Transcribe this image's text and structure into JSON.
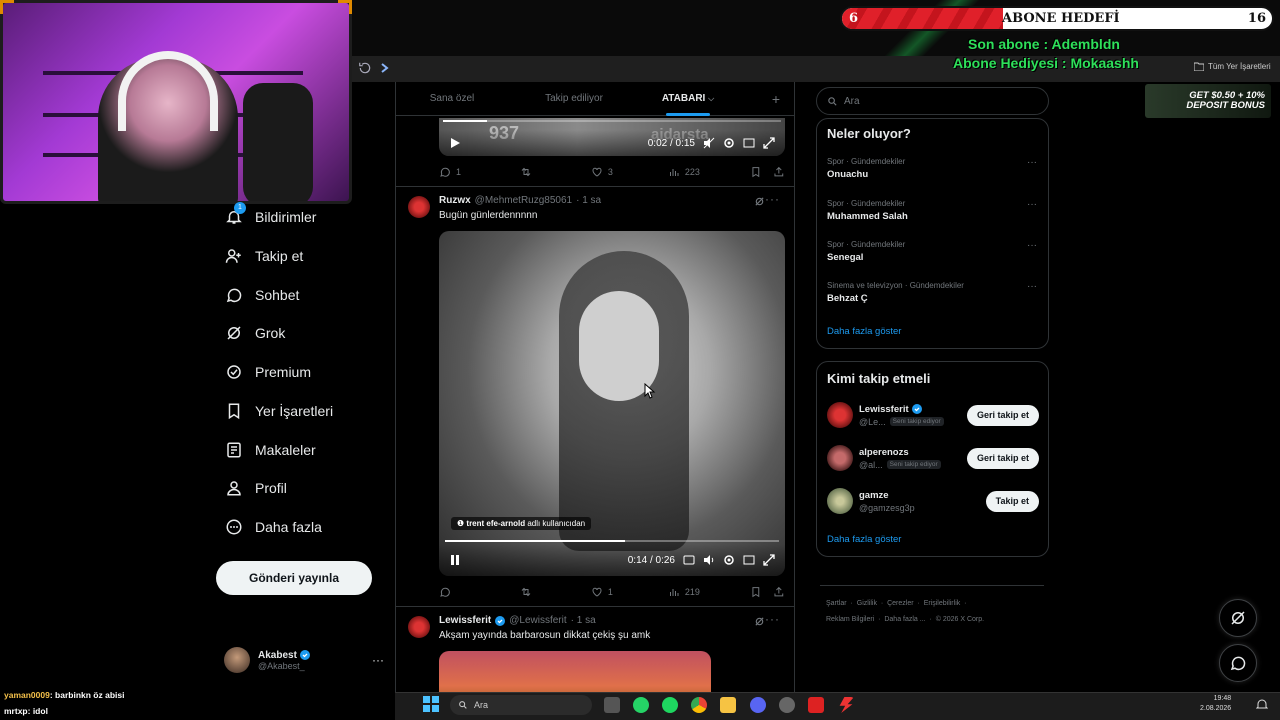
{
  "nav": {
    "items": [
      {
        "label": "Bildirimler",
        "icon": "bell-icon",
        "badge": "1"
      },
      {
        "label": "Takip et",
        "icon": "person-add-icon"
      },
      {
        "label": "Sohbet",
        "icon": "chat-icon"
      },
      {
        "label": "Grok",
        "icon": "grok-icon"
      },
      {
        "label": "Premium",
        "icon": "premium-icon"
      },
      {
        "label": "Yer İşaretleri",
        "icon": "bookmark-icon"
      },
      {
        "label": "Makaleler",
        "icon": "article-icon"
      },
      {
        "label": "Profil",
        "icon": "person-icon"
      },
      {
        "label": "Daha fazla",
        "icon": "more-circle-icon"
      }
    ],
    "post_button": "Gönderi yayınla",
    "profile": {
      "name": "Akabest",
      "handle": "@Akabest_"
    }
  },
  "timeline": {
    "tabs": [
      "Sana özel",
      "Takip ediliyor",
      "ATABARI"
    ],
    "active_tab": "ATABARI",
    "tweet1": {
      "video_time": "0:02 / 0:15",
      "overlay_num": "937",
      "overlay_word": "aidarsta",
      "replies": "1",
      "likes": "3",
      "views": "223",
      "progress": 0.13
    },
    "tweet2": {
      "name": "Ruzwx",
      "handle": "@MehmetRuzg85061",
      "time": "· 1 sa",
      "text": "Bugün günlerdennnnn",
      "video_time": "0:14 / 0:26",
      "tag_user": "trent efe-arnold",
      "tag_suffix": "adlı kullanıcıdan",
      "replies": "",
      "likes": "1",
      "views": "219",
      "progress": 0.54
    },
    "tweet3": {
      "name": "Lewissferit",
      "handle": "@Lewissferit",
      "time": "· 1 sa",
      "text": "Akşam yayında barbarosun dikkat çekiş şu amk"
    }
  },
  "sidebar": {
    "search_placeholder": "Ara",
    "trends_title": "Neler oluyor?",
    "trends": [
      {
        "category": "Spor · Gündemdekiler",
        "title": "Onuachu"
      },
      {
        "category": "Spor · Gündemdekiler",
        "title": "Muhammed Salah"
      },
      {
        "category": "Spor · Gündemdekiler",
        "title": "Senegal"
      },
      {
        "category": "Sinema ve televizyon · Gündemdekiler",
        "title": "Behzat Ç"
      }
    ],
    "show_more": "Daha fazla göster",
    "who_title": "Kimi takip etmeli",
    "who": [
      {
        "name": "Lewissferit",
        "handle": "@Le...",
        "follows_you": "Seni takip ediyor",
        "button": "Geri takip et",
        "verified": true
      },
      {
        "name": "alperenozs",
        "handle": "@al...",
        "follows_you": "Seni takip ediyor",
        "button": "Geri takip et",
        "verified": false
      },
      {
        "name": "gamze",
        "handle": "@gamzesg3p",
        "follows_you": "",
        "button": "Takip et",
        "verified": false
      }
    ],
    "who_more": "Daha fazla göster",
    "footer_row1": [
      "Şartlar",
      "Gizlilik",
      "Çerezler",
      "Erişilebilirlik"
    ],
    "footer_row2": [
      "Reklam Bilgileri",
      "Daha fazla ...",
      "© 2026 X Corp."
    ]
  },
  "overlay": {
    "goal_current": "6",
    "goal_label": "ABONE HEDEFİ",
    "goal_target": "16",
    "goal_progress": 0.375,
    "last_sub": "Son abone : Adembldn",
    "gift_sub": "Abone Hediyesi : Mokaashh",
    "bonus_text_1": "GET $0.50 + 10%",
    "bonus_text_2": "DEPOSIT BONUS",
    "bookmarks_label": "Tüm Yer İşaretleri"
  },
  "chat": [
    {
      "user": "yaman0009",
      "message": ": barbinkn öz abisi"
    },
    {
      "user": "mrtxp",
      "message": ": idol"
    }
  ],
  "taskbar": {
    "search": "Ara",
    "time": "19:48",
    "date": "2.08.2026"
  },
  "colors": {
    "accent": "#1d9bf0",
    "goal_red": "#e0202a",
    "overlay_green": "#2ee05a"
  }
}
